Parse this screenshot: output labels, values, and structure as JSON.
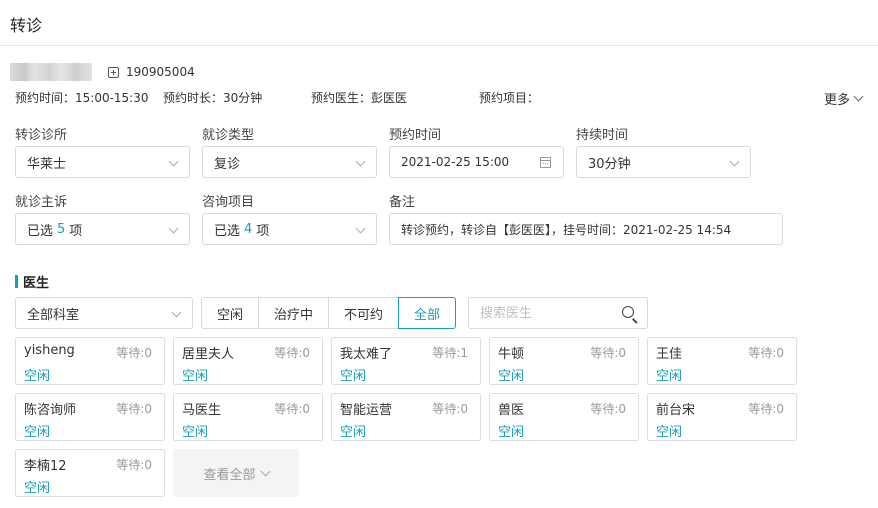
{
  "page": {
    "title": "转诊"
  },
  "patient": {
    "id": "190905004"
  },
  "appointment": {
    "time": "预约时间：15:00-15:30",
    "duration": "预约时长：30分钟",
    "doctor": "预约医生：彭医医",
    "project": "预约项目：",
    "more_label": "更多"
  },
  "form": {
    "clinic": {
      "label": "转诊诊所",
      "value": "华莱士"
    },
    "visit_type": {
      "label": "就诊类型",
      "value": "复诊"
    },
    "appt_time": {
      "label": "预约时间",
      "value": "2021-02-25 15:00"
    },
    "lasting": {
      "label": "持续时间",
      "value": "30分钟"
    },
    "complaint": {
      "label": "就诊主诉",
      "prefix": "已选",
      "count": "5",
      "suffix": "项"
    },
    "consult": {
      "label": "咨询项目",
      "prefix": "已选",
      "count": "4",
      "suffix": "项"
    },
    "remark": {
      "label": "备注",
      "value": "转诊预约，转诊自【彭医医】，挂号时间：2021-02-25 14:54"
    }
  },
  "doctors_section": {
    "title": "医生",
    "department": "全部科室",
    "filters": [
      "空闲",
      "治疗中",
      "不可约",
      "全部"
    ],
    "active_filter": "全部",
    "search_placeholder": "搜索医生",
    "view_all": "查看全部"
  },
  "doctors": [
    {
      "name": "yisheng",
      "wait": "等待:0",
      "status": "空闲"
    },
    {
      "name": "居里夫人",
      "wait": "等待:0",
      "status": "空闲"
    },
    {
      "name": "我太难了",
      "wait": "等待:1",
      "status": "空闲"
    },
    {
      "name": "牛顿",
      "wait": "等待:0",
      "status": "空闲"
    },
    {
      "name": "王佳",
      "wait": "等待:0",
      "status": "空闲"
    },
    {
      "name": "陈咨询师",
      "wait": "等待:0",
      "status": "空闲"
    },
    {
      "name": "马医生",
      "wait": "等待:0",
      "status": "空闲"
    },
    {
      "name": "智能运营",
      "wait": "等待:0",
      "status": "空闲"
    },
    {
      "name": "兽医",
      "wait": "等待:0",
      "status": "空闲"
    },
    {
      "name": "前台宋",
      "wait": "等待:0",
      "status": "空闲"
    },
    {
      "name": "李楠12",
      "wait": "等待:0",
      "status": "空闲"
    }
  ],
  "colors": {
    "accent": "#1a9eb5",
    "border": "#d9d9d9",
    "muted": "#999999"
  }
}
